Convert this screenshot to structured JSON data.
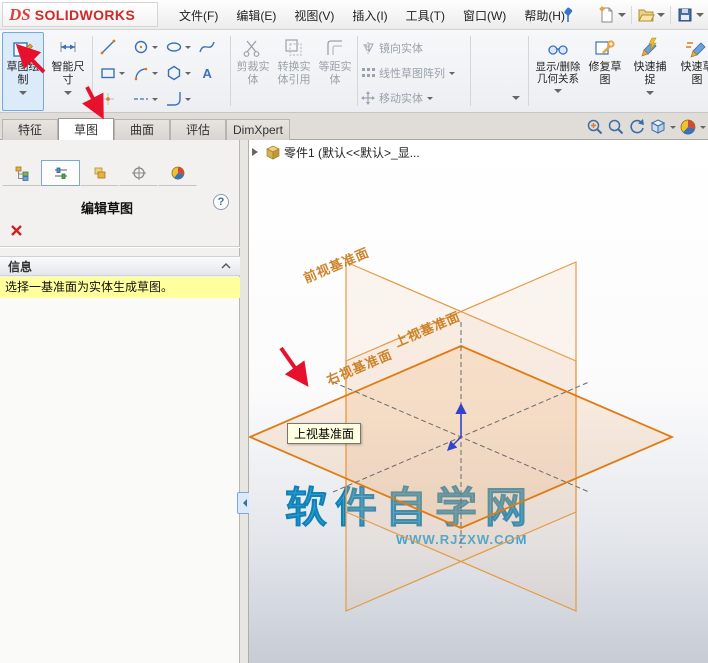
{
  "colors": {
    "accent_blue": "#2e7fc2",
    "plane_orange": "#e07b12",
    "message_yellow": "#ffff9c",
    "watermark_blue": "#2ba3dc",
    "annotation_red": "#e8112d",
    "brand_red": "#cc2a27",
    "active_button_bg": "#dcebfa"
  },
  "brand": {
    "mark": "DS",
    "name": "SOLIDWORKS"
  },
  "menubar": {
    "menus": [
      "文件(F)",
      "编辑(E)",
      "视图(V)",
      "插入(I)",
      "工具(T)",
      "窗口(W)",
      "帮助(H)"
    ],
    "quick_tools": [
      "new-document",
      "open",
      "save"
    ]
  },
  "ribbon": {
    "sketch_draw": "草图绘制",
    "smart_dimension": "智能尺寸",
    "trim": "剪裁实体",
    "convert": "转换实体引用",
    "offset": "等距实体",
    "mirror": "镜向实体",
    "linear_pattern": "线性草图阵列",
    "move": "移动实体",
    "relations": "显示/删除几何关系",
    "repair": "修复草图",
    "quick_snaps": "快速捕捉",
    "rapid_sketch": "快速草图",
    "text_tool_glyph": "A",
    "sketch_tools": [
      "line",
      "circle",
      "ellipse",
      "spline",
      "rectangle",
      "arc",
      "polygon",
      "text",
      "point",
      "centerline",
      "fillet"
    ]
  },
  "tabs": {
    "items": [
      "特征",
      "草图",
      "曲面",
      "评估",
      "DimXpert"
    ],
    "active": "草图"
  },
  "panel": {
    "title": "编辑草图",
    "help_glyph": "?",
    "message_header": "信息",
    "message": "选择一基准面为实体生成草图。"
  },
  "viewport": {
    "tree_label": "零件1 (默认<<默认>_显...",
    "planes": {
      "front": "前视基准面",
      "top": "上视基准面",
      "right": "右视基准面"
    },
    "tooltip": "上视基准面",
    "watermark_title": "软件自学网",
    "watermark_url": "WWW.RJZXW.COM"
  }
}
